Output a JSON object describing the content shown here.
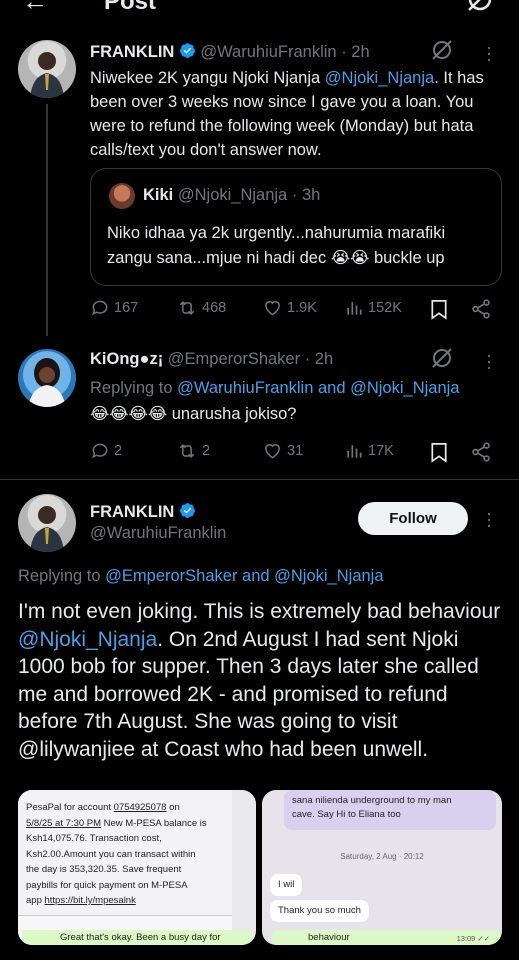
{
  "header": {
    "title": "Post",
    "back_icon": "arrow-left-icon",
    "grok_icon": "grok-icon"
  },
  "tweet1": {
    "name": "FRANKLIN",
    "handle": "@WaruhiuFranklin",
    "sep": "·",
    "time": "2h",
    "text_a": "Niwekee 2K yangu Njoki Njanja ",
    "mention": "@Njoki_Njanja",
    "text_b": ". It has been over 3 weeks now since I gave you a loan. You were to refund the following week (Monday) but hata calls/text you don't answer now.",
    "quote": {
      "name": "Kiki",
      "handle": "@Njoki_Njanja",
      "sep": "·",
      "time": "3h",
      "text": "Niko idhaa ya 2k urgently...nahurumia marafiki zangu sana...mjue ni hadi dec 😭😭 buckle up"
    },
    "stats": {
      "replies": "167",
      "reposts": "468",
      "likes": "1.9K",
      "views": "152K"
    }
  },
  "tweet2": {
    "name": "KiOng●z¡",
    "handle": "@EmperorShaker",
    "sep": "·",
    "time": "2h",
    "replying_prefix": "Replying to ",
    "replying_mentions": "@WaruhiuFranklin and @Njoki_Njanja",
    "text_emoji": "😂😂😂😂",
    "text": " unarusha jokiso?",
    "stats": {
      "replies": "2",
      "reposts": "2",
      "likes": "31",
      "views": "17K"
    }
  },
  "main": {
    "name": "FRANKLIN",
    "handle": "@WaruhiuFranklin",
    "follow_label": "Follow",
    "replying_prefix": "Replying to ",
    "replying_mentions": "@EmperorShaker and @Njoki_Njanja",
    "text_a": "I'm not even joking. This is extremely bad behaviour ",
    "mention": "@Njoki_Njanja",
    "text_b": ". On 2nd August I had sent Njoki 1000 bob for supper. Then 3 days later she called me and borrowed 2K - and promised to refund before 7th August. She was going to visit @lilywanjiee at Coast who had been unwell."
  },
  "media": {
    "sms_l1_a": "PesaPal for account ",
    "sms_l1_b": "0754925078",
    "sms_l1_c": " on",
    "sms_l2_a": "5/8/25",
    "sms_l2_b": " at 7:30 PM",
    "sms_l2_c": " New M-PESA balance is",
    "sms_l3": "Ksh14,075.76. Transaction cost,",
    "sms_l4": "Ksh2.00.Amount you can transact within",
    "sms_l5": "the day is 353,320.35. Save frequent",
    "sms_l6": "paybills for quick payment on M-PESA",
    "sms_l7_a": "app ",
    "sms_l7_b": "https://bit.ly/mpesalnk",
    "wa1_text": "Great that's okay. Been a busy day for",
    "chat_top_a": "sana nilienda underground to my man",
    "chat_top_b": "cave. Say Hi to Eliana too",
    "chat_date": "Saturday, 2 Aug · 20:12",
    "chat_l1": "I wil",
    "chat_l2": "Thank you so much",
    "chat_green": "behaviour",
    "chat_green_time": "13:09 ✓✓"
  },
  "colors": {
    "background": "#000000",
    "text": "#e7e9ea",
    "secondary": "#71767b",
    "link": "#4b9fe6",
    "verified": "#1d9bf0",
    "divider": "#2f3336",
    "follow_bg": "#eff3f4"
  }
}
